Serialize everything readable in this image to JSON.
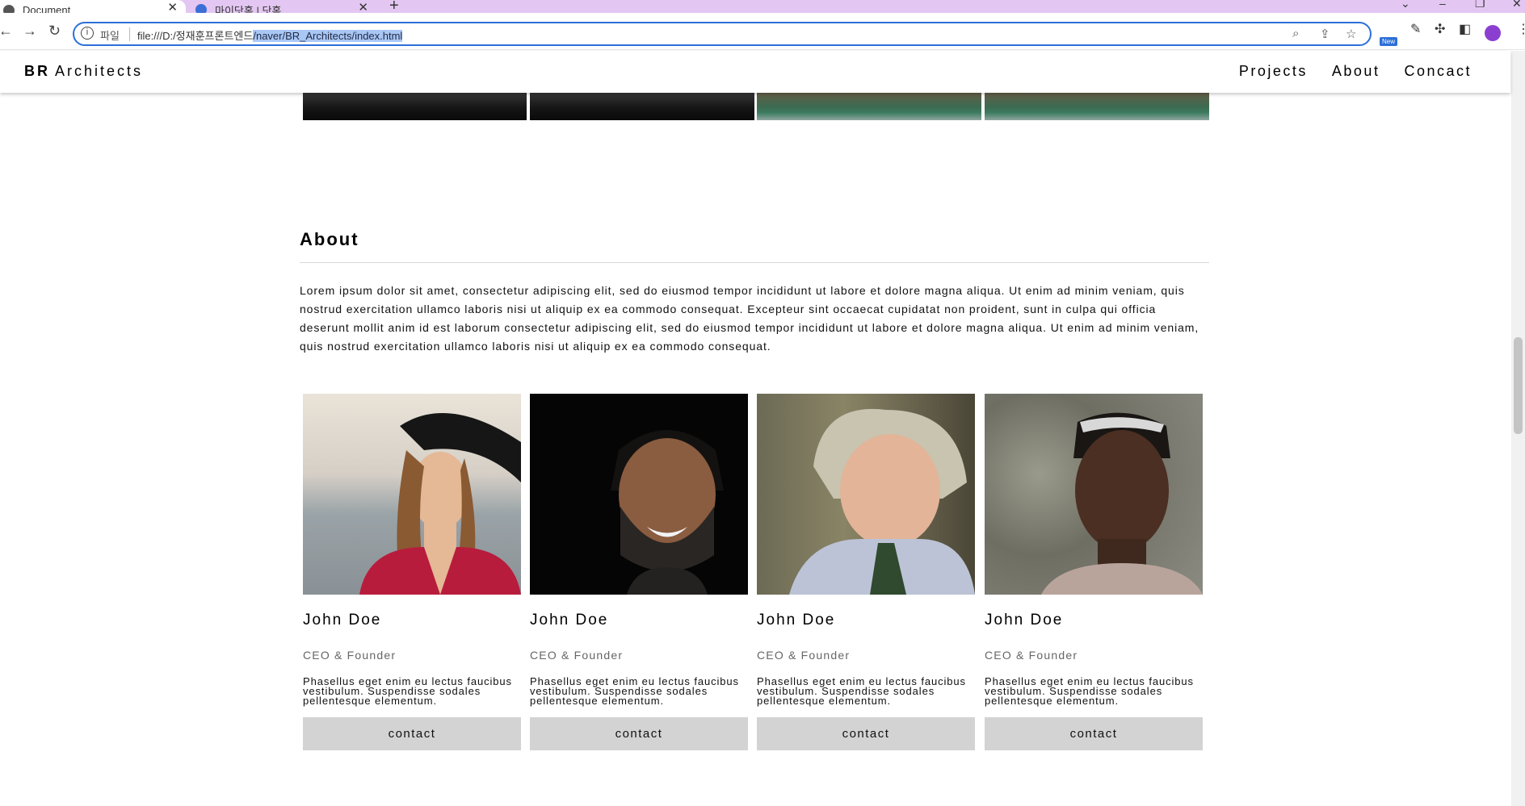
{
  "browser": {
    "tabs": [
      {
        "title": "Document",
        "close": "✕"
      },
      {
        "title": "마이닷홈 | 닷홈",
        "close": "✕"
      }
    ],
    "new_tab": "+",
    "omnibox": {
      "scheme_label": "파일",
      "url_prefix": "file:///D:/정재훈프론트엔드",
      "url_selected": "/naver/BR_Architects/index.html"
    },
    "ext_badge": "New"
  },
  "site": {
    "logo_bold": "BR",
    "logo_text": "Architects",
    "nav": [
      "Projects",
      "About",
      "Concact"
    ]
  },
  "about": {
    "title": "About",
    "body": "Lorem ipsum dolor sit amet, consectetur adipiscing elit, sed do eiusmod tempor incididunt ut labore et dolore magna aliqua. Ut enim ad minim veniam, quis nostrud exercitation ullamco laboris nisi ut aliquip ex ea commodo consequat. Excepteur sint occaecat cupidatat non proident, sunt in culpa qui officia deserunt mollit anim id est laborum consectetur adipiscing elit, sed do eiusmod tempor incididunt ut labore et dolore magna aliqua. Ut enim ad minim veniam, quis nostrud exercitation ullamco laboris nisi ut aliquip ex ea commodo consequat."
  },
  "team": [
    {
      "name": "John Doe",
      "role": "CEO & Founder",
      "desc": "Phasellus eget enim eu lectus faucibus vestibulum. Suspendisse sodales pellentesque elementum.",
      "button": "contact"
    },
    {
      "name": "John Doe",
      "role": "CEO & Founder",
      "desc": "Phasellus eget enim eu lectus faucibus vestibulum. Suspendisse sodales pellentesque elementum.",
      "button": "contact"
    },
    {
      "name": "John Doe",
      "role": "CEO & Founder",
      "desc": "Phasellus eget enim eu lectus faucibus vestibulum. Suspendisse sodales pellentesque elementum.",
      "button": "contact"
    },
    {
      "name": "John Doe",
      "role": "CEO & Founder",
      "desc": "Phasellus eget enim eu lectus faucibus vestibulum. Suspendisse sodales pellentesque elementum.",
      "button": "contact"
    }
  ],
  "colors": {
    "tabbar": "#e3c7f2",
    "omnibox_border": "#2c6fd8",
    "button_bg": "#d3d3d3"
  }
}
